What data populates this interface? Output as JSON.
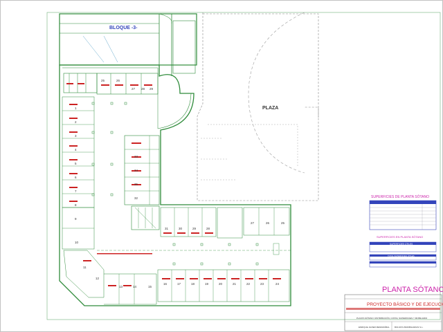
{
  "plan": {
    "block_label": "BLOQUE -3-",
    "plaza_label": "PLAZA",
    "top_numbers": [
      "25",
      "26",
      "27",
      "28",
      "29"
    ],
    "left_numbers": [
      "1",
      "2",
      "3",
      "4",
      "5",
      "6",
      "7",
      "8",
      "9",
      "10",
      "11",
      "12"
    ],
    "center_numbers": [
      "33",
      "34",
      "35",
      "32"
    ],
    "middle_numbers": [
      "31",
      "30",
      "29",
      "28",
      "27",
      "26",
      "25"
    ],
    "bottom_numbers": [
      "13",
      "14",
      "15",
      "16",
      "17",
      "18",
      "19",
      "20",
      "21",
      "22",
      "23",
      "24"
    ]
  },
  "surfaces": {
    "title": "SUPERFICIES DE PLANTA SÓTANO",
    "subtitle": "SUPERFICIES EN PLANTA SÓTANO",
    "subtitle2": "SUPERFICIES ÚTILES",
    "subtitle3": "TOTAL SUPERFICIES ÚTILES"
  },
  "title_block": {
    "sheet_title": "PLANTA SÓTANO",
    "project_title": "PROYECTO BÁSICO Y DE EJECUCIÓN",
    "sheet_subtitle": "PLANTA SÓTANO: DISTRIBUCIÓN, COTAS, SUPERFICIES Y MOBILIARIO",
    "author": "ENRIQUE JAVIER MENDIZÁBAL",
    "client": "BOLSITA INMOBILIARIAS S.L."
  },
  "colors": {
    "walls": "#2e8b3a",
    "text_magenta": "#cc22aa",
    "labels_red": "#cc2222",
    "blue": "#3344bb"
  }
}
